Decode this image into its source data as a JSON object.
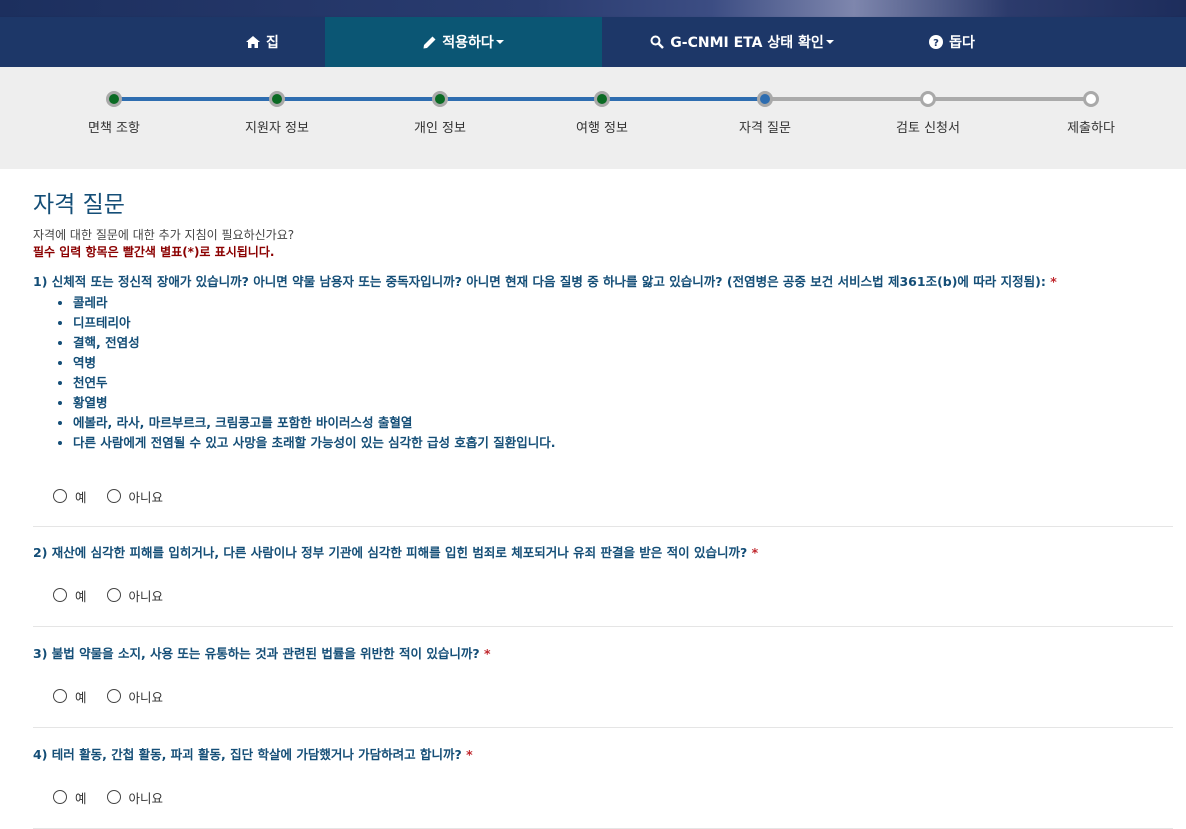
{
  "nav": {
    "items": [
      {
        "label": "집",
        "icon": "home-icon"
      },
      {
        "label": "적용하다",
        "icon": "pencil-icon"
      },
      {
        "label": "G-CNMI ETA 상태 확인",
        "icon": "search-icon"
      },
      {
        "label": "돕다",
        "icon": "help-icon"
      }
    ]
  },
  "steps": [
    {
      "label": "면책 조항",
      "state": "done"
    },
    {
      "label": "지원자 정보",
      "state": "done"
    },
    {
      "label": "개인 정보",
      "state": "done"
    },
    {
      "label": "여행 정보",
      "state": "done"
    },
    {
      "label": "자격 질문",
      "state": "current"
    },
    {
      "label": "검토 신청서",
      "state": "todo"
    },
    {
      "label": "제출하다",
      "state": "todo"
    }
  ],
  "page": {
    "title": "자격 질문",
    "help_link": "자격에 대한 질문에 대한 추가 지침이 필요하신가요?",
    "required_note": "필수 입력 항목은 빨간색 별표(*)로 표시됩니다."
  },
  "questions": [
    {
      "text": "1) 신체적 또는 정신적 장애가 있습니까? 아니면 약물 남용자 또는 중독자입니까? 아니면 현재 다음 질병 중 하나를 앓고 있습니까? (전염병은 공중 보건 서비스법 제361조(b)에 따라 지정됨):"
    },
    {
      "text": "2) 재산에 심각한 피해를 입히거나, 다른 사람이나 정부 기관에 심각한 피해를 입힌 범죄로 체포되거나 유죄 판결을 받은 적이 있습니까?"
    },
    {
      "text": "3) 불법 약물을 소지, 사용 또는 유통하는 것과 관련된 법률을 위반한 적이 있습니까?"
    },
    {
      "text": "4) 테러 활동, 간첩 활동, 파괴 활동, 집단 학살에 가담했거나 가담하려고 합니까?"
    }
  ],
  "diseases": [
    "콜레라",
    "디프테리아",
    "결핵, 전염성",
    "역병",
    "천연두",
    "황열병",
    "에볼라, 라사, 마르부르크, 크림콩고를 포함한 바이러스성 출혈열",
    "다른 사람에게 전염될 수 있고 사망을 초래할 가능성이 있는 심각한 급성 호흡기 질환입니다."
  ],
  "radio": {
    "yes": "예",
    "no": "아니요"
  },
  "required_mark": "*",
  "colors": {
    "nav_bg": "#1d3768",
    "nav_active": "#0b5674",
    "done": "#0a6a23",
    "current": "#2e6db0",
    "question_text": "#144e77",
    "required": "#c0272d"
  }
}
